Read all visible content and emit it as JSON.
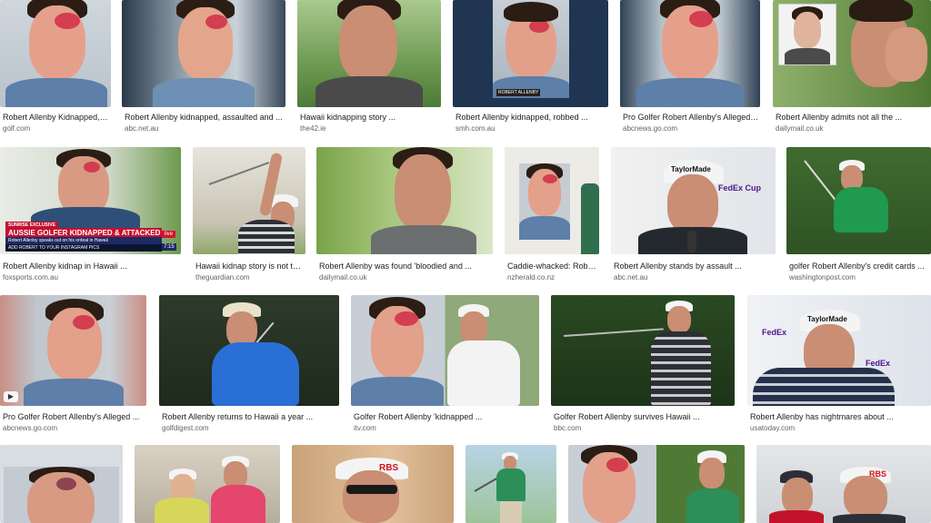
{
  "results": [
    {
      "caption": "Robert Allenby Kidnapped, B...",
      "source": "golf.com"
    },
    {
      "caption": "Robert Allenby kidnapped, assaulted and ...",
      "source": "abc.net.au"
    },
    {
      "caption": "Hawaii kidnapping story ...",
      "source": "the42.ie"
    },
    {
      "caption": "Robert Allenby kidnapped, robbed ...",
      "source": "smh.com.au"
    },
    {
      "caption": "Pro Golfer Robert Allenby's Alleged ...",
      "source": "abcnews.go.com"
    },
    {
      "caption": "Robert Allenby admits not all the ...",
      "source": "dailymail.co.uk"
    },
    {
      "caption": "Robert Allenby kidnap in Hawaii ...",
      "source": "foxsports.com.au"
    },
    {
      "caption": "Hawaii kidnap story is not tru...",
      "source": "theguardian.com"
    },
    {
      "caption": "Robert Allenby was found 'bloodied and ...",
      "source": "dailymail.co.uk"
    },
    {
      "caption": "Caddie-whacked: Robert...",
      "source": "nzherald.co.nz"
    },
    {
      "caption": "Robert Allenby stands by assault ...",
      "source": "abc.net.au"
    },
    {
      "caption": "golfer Robert Allenby's credit cards ...",
      "source": "washingtonpost.com"
    },
    {
      "caption": "Pro Golfer Robert Allenby's Alleged ...",
      "source": "abcnews.go.com"
    },
    {
      "caption": "Robert Allenby returns to Hawaii a year ...",
      "source": "golfdigest.com"
    },
    {
      "caption": "Golfer Robert Allenby 'kidnapped ...",
      "source": "itv.com"
    },
    {
      "caption": "Golfer Robert Allenby survives Hawaii ...",
      "source": "bbc.com"
    },
    {
      "caption": "Robert Allenby has nightmares about ...",
      "source": "usatoday.com"
    }
  ],
  "overlays": {
    "smh_name": "ROBERT ALLENBY",
    "tv_channel": "SUNRISE EXCLUSIVE",
    "tv_headline": "AUSSIE GOLFER KIDNAPPED & ATTACKED",
    "tv_subline": "Robert Allenby speaks out on his ordeal in Hawaii",
    "tv_ticker": "ADD ROBERT TO YOUR INSTAGRAM PICS",
    "tv_live": "live",
    "tv_time": "7:15",
    "brand_taylormade": "TaylorMade",
    "brand_fedex": "FedEx Cup",
    "brand_fedex_short": "FedEx",
    "brand_rbs": "RBS",
    "play_symbol": "▶"
  },
  "colors": {
    "skin": "#e3a58c",
    "bruise": "#cd1e3c",
    "grass": "#5f8f3a"
  }
}
